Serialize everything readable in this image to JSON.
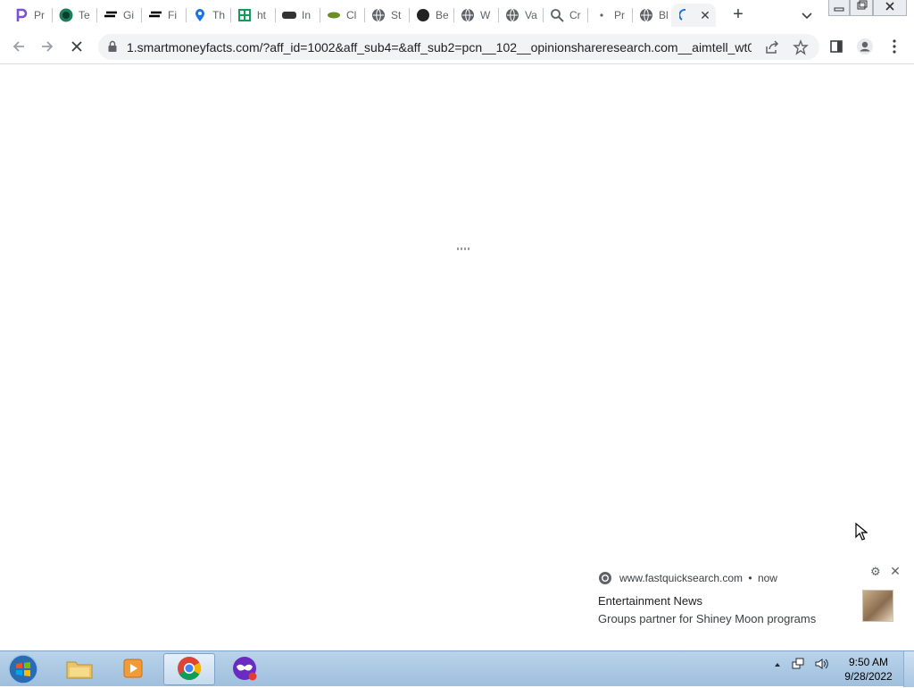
{
  "browser": {
    "tabs": [
      {
        "title": "Pr",
        "icon": "letter-p-icon",
        "color": "#7b4fd6"
      },
      {
        "title": "Te",
        "icon": "te-icon",
        "color": "#1a7f5a"
      },
      {
        "title": "Gi",
        "icon": "stripes-icon",
        "color": "#000000"
      },
      {
        "title": "Fi",
        "icon": "stripes-icon",
        "color": "#000000"
      },
      {
        "title": "Th",
        "icon": "map-pin-icon",
        "color": "#1a73e8"
      },
      {
        "title": "ht",
        "icon": "gift-icon",
        "color": "#0f9d58"
      },
      {
        "title": "In",
        "icon": "badge-icon",
        "color": "#333333"
      },
      {
        "title": "Cl",
        "icon": "leaf-icon",
        "color": "#6b8e23"
      },
      {
        "title": "St",
        "icon": "globe-icon",
        "color": "#5f6368"
      },
      {
        "title": "Be",
        "icon": "dark-circle-icon",
        "color": "#222222"
      },
      {
        "title": "W",
        "icon": "globe-icon",
        "color": "#5f6368"
      },
      {
        "title": "Va",
        "icon": "globe-icon",
        "color": "#5f6368"
      },
      {
        "title": "Cr",
        "icon": "magnifier-icon",
        "color": "#5f6368"
      },
      {
        "title": "Pr",
        "icon": "dot-icon",
        "color": "#5f6368"
      },
      {
        "title": "Bl",
        "icon": "globe-icon",
        "color": "#5f6368"
      }
    ],
    "active_tab": {
      "title": "",
      "icon": "loading-spinner-icon",
      "close": "✕"
    },
    "new_tab": "+",
    "address": {
      "url": "1.smartmoneyfacts.com/?aff_id=1002&aff_sub4=&aff_sub2=pcn__102__opinionshareresearch.com__aimtell_wt0..."
    }
  },
  "notification": {
    "source": "www.fastquicksearch.com",
    "time": "now",
    "separator": "•",
    "title": "Entertainment News",
    "body": "Groups partner for Shiney Moon programs"
  },
  "taskbar": {
    "time": "9:50 AM",
    "date": "9/28/2022"
  },
  "colors": {
    "accent": "#1a73e8",
    "taskbar": "#a8c6e4"
  }
}
